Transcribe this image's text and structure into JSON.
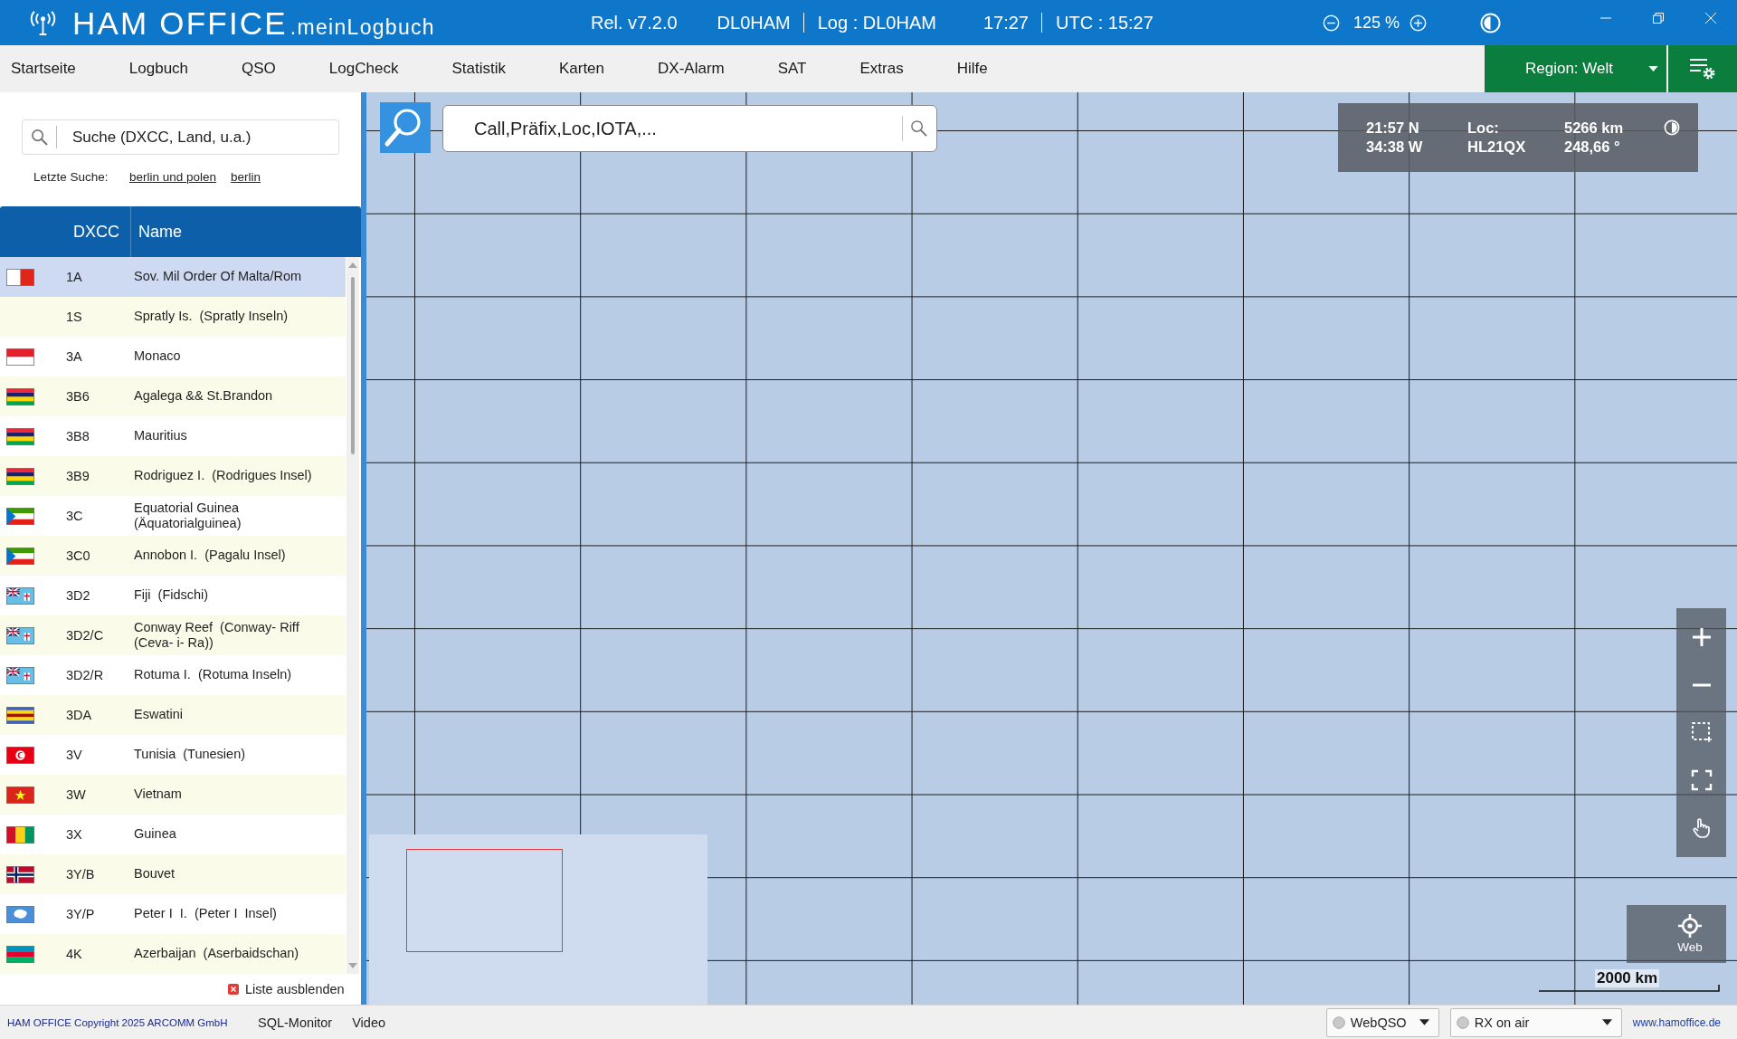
{
  "title_bar": {
    "app_name": "HAM OFFICE",
    "app_suffix": ".meinLogbuch",
    "release": "Rel. v7.2.0",
    "station": "DL0HAM",
    "log": "Log : DL0HAM",
    "time": "17:27",
    "utc": "UTC : 15:27",
    "zoom": "125 %"
  },
  "menu": [
    "Startseite",
    "Logbuch",
    "QSO",
    "LogCheck",
    "Statistik",
    "Karten",
    "DX-Alarm",
    "SAT",
    "Extras",
    "Hilfe"
  ],
  "region": "Region: Welt",
  "sidebar": {
    "search": {
      "placeholder": "Suche (DXCC, Land, u.a.)"
    },
    "recent_label": "Letzte Suche:",
    "recent": [
      "berlin und polen",
      "berlin"
    ],
    "table": {
      "columns": [
        "DXCC",
        "Name"
      ],
      "rows": [
        {
          "dxcc": "1A",
          "name": "Sov. Mil Order Of Malta/Rom",
          "selected": true,
          "flag": {
            "kind": "v-stripes",
            "parts": [
              {
                "color": "#ffffff"
              },
              {
                "color": "#e0261b"
              }
            ]
          }
        },
        {
          "dxcc": "1S",
          "name": "Spratly Is.  (Spratly Inseln)",
          "selected": false
        },
        {
          "dxcc": "3A",
          "name": "Monaco",
          "selected": false,
          "flag": {
            "kind": "h-stripes",
            "parts": [
              {
                "color": "#e3202c"
              },
              {
                "color": "#ffffff"
              }
            ]
          }
        },
        {
          "dxcc": "3B6",
          "name": "Agalega && St.Brandon",
          "selected": false,
          "flag": {
            "kind": "h-stripes",
            "parts": [
              {
                "color": "#ea2839"
              },
              {
                "color": "#1a206d"
              },
              {
                "color": "#ffd500"
              },
              {
                "color": "#00a551"
              }
            ]
          }
        },
        {
          "dxcc": "3B8",
          "name": "Mauritius",
          "selected": false,
          "flag": {
            "kind": "h-stripes",
            "parts": [
              {
                "color": "#ea2839"
              },
              {
                "color": "#1a206d"
              },
              {
                "color": "#ffd500"
              },
              {
                "color": "#00a551"
              }
            ]
          }
        },
        {
          "dxcc": "3B9",
          "name": "Rodriguez I.  (Rodrigues Insel)",
          "selected": false,
          "flag": {
            "kind": "h-stripes",
            "parts": [
              {
                "color": "#ea2839"
              },
              {
                "color": "#1a206d"
              },
              {
                "color": "#ffd500"
              },
              {
                "color": "#00a551"
              }
            ]
          }
        },
        {
          "dxcc": "3C",
          "name": "Equatorial Guinea  (Äquatorialguinea)",
          "selected": false,
          "flag": {
            "kind": "hoist-triangle",
            "parts": [
              {
                "color": "#3e9a00"
              },
              {
                "color": "#ffffff"
              },
              {
                "color": "#e32118"
              },
              {
                "color": "#0073ce"
              }
            ]
          }
        },
        {
          "dxcc": "3C0",
          "name": "Annobon I.  (Pagalu Insel)",
          "selected": false,
          "flag": {
            "kind": "hoist-triangle",
            "parts": [
              {
                "color": "#3e9a00"
              },
              {
                "color": "#ffffff"
              },
              {
                "color": "#e32118"
              },
              {
                "color": "#0073ce"
              }
            ]
          }
        },
        {
          "dxcc": "3D2",
          "name": "Fiji  (Fidschi)",
          "selected": false,
          "flag": {
            "kind": "canton",
            "parts": [
              {
                "color": "#68bfe5"
              },
              {
                "color": "#012169"
              },
              {
                "color": "#c8102e"
              }
            ]
          }
        },
        {
          "dxcc": "3D2/C",
          "name": "Conway Reef  (Conway- Riff (Ceva- i- Ra))",
          "selected": false,
          "flag": {
            "kind": "canton",
            "parts": [
              {
                "color": "#68bfe5"
              },
              {
                "color": "#012169"
              },
              {
                "color": "#c8102e"
              }
            ]
          }
        },
        {
          "dxcc": "3D2/R",
          "name": "Rotuma I.  (Rotuma Inseln)",
          "selected": false,
          "flag": {
            "kind": "canton",
            "parts": [
              {
                "color": "#68bfe5"
              },
              {
                "color": "#012169"
              },
              {
                "color": "#c8102e"
              }
            ]
          }
        },
        {
          "dxcc": "3DA",
          "name": "Eswatini",
          "selected": false,
          "flag": {
            "kind": "h-stripes",
            "parts": [
              {
                "color": "#3e5eb9"
              },
              {
                "color": "#ffd900"
              },
              {
                "color": "#b10c0c"
              },
              {
                "color": "#ffd900"
              },
              {
                "color": "#3e5eb9"
              }
            ]
          }
        },
        {
          "dxcc": "3V",
          "name": "Tunisia  (Tunesien)",
          "selected": false,
          "flag": {
            "kind": "crescent",
            "parts": [
              {
                "color": "#e70013"
              },
              {
                "color": "#ffffff"
              }
            ]
          }
        },
        {
          "dxcc": "3W",
          "name": "Vietnam",
          "selected": false,
          "flag": {
            "kind": "star",
            "parts": [
              {
                "color": "#da251d"
              },
              {
                "color": "#ffff00"
              }
            ]
          }
        },
        {
          "dxcc": "3X",
          "name": "Guinea",
          "selected": false,
          "flag": {
            "kind": "v-stripes",
            "parts": [
              {
                "color": "#ce1126"
              },
              {
                "color": "#fcd116"
              },
              {
                "color": "#009460"
              }
            ]
          }
        },
        {
          "dxcc": "3Y/B",
          "name": "Bouvet",
          "selected": false,
          "flag": {
            "kind": "nordic-cross",
            "parts": [
              {
                "color": "#ba0c2f"
              },
              {
                "color": "#ffffff"
              },
              {
                "color": "#00205b"
              }
            ]
          }
        },
        {
          "dxcc": "3Y/P",
          "name": "Peter I  I.  (Peter I  Insel)",
          "selected": false,
          "flag": {
            "kind": "disc",
            "parts": [
              {
                "color": "#4a8fd8"
              },
              {
                "color": "#ffffff"
              }
            ]
          }
        },
        {
          "dxcc": "4K",
          "name": "Azerbaijan  (Aserbaidschan)",
          "selected": false,
          "flag": {
            "kind": "h-stripes",
            "parts": [
              {
                "color": "#0092bc"
              },
              {
                "color": "#e4002b"
              },
              {
                "color": "#00af66"
              }
            ]
          }
        }
      ]
    },
    "hide_list": "Liste ausblenden"
  },
  "map": {
    "search": {
      "placeholder": "Call,Präfix,Loc,IOTA,..."
    },
    "position": {
      "lat": "21:57 N",
      "lon": "34:38 W",
      "loc_label": "Loc:",
      "locator": "HL21QX",
      "distance": "5266 km",
      "bearing": "248,66 °"
    },
    "web_button": "Web",
    "scale": "2000 km"
  },
  "status_bar": {
    "copyright": "HAM OFFICE Copyright 2025 ARCOMM GmbH",
    "links": [
      "SQL-Monitor",
      "Video"
    ],
    "dropdowns": [
      {
        "label": "WebQSO",
        "on": false
      },
      {
        "label": "RX on air",
        "on": false
      }
    ],
    "website": "www.hamoffice.de"
  }
}
